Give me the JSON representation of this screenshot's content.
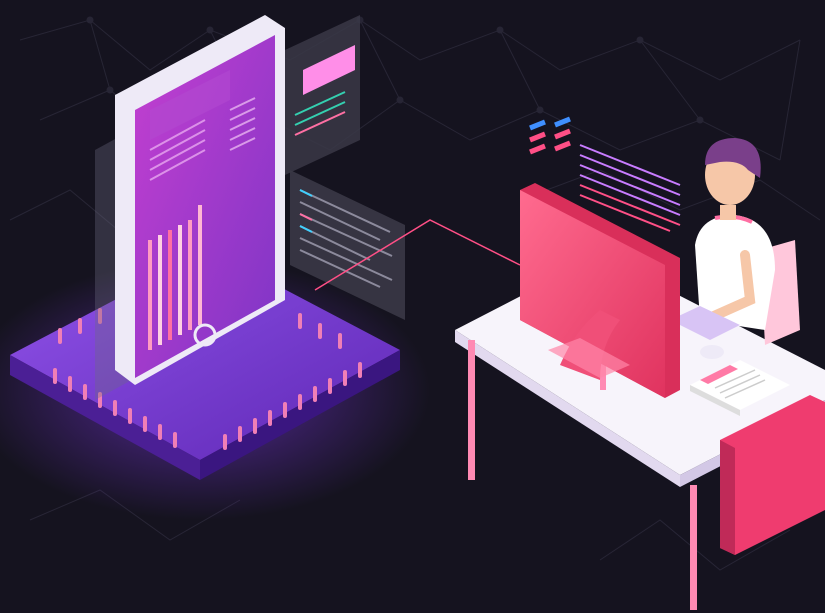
{
  "scene": {
    "description_hidden": "",
    "colors": {
      "background": "#15131f",
      "network": "#2a2838",
      "chip_top": "#7c3fd6",
      "chip_side": "#4b1f95",
      "chip_pin": "#f07fb6",
      "phone_frame": "#eeeaf7",
      "phone_screen": "#9a39c9",
      "accent_pink": "#ff4f86",
      "monitor": "#f04f78",
      "desk_top": "#f7f4fb",
      "desk_leg": "#ff8ab3",
      "cabinet": "#ef3c6f",
      "hair": "#7a3f8a",
      "skin": "#f6c7a8",
      "shirt": "#ffffff",
      "code_panel": "#3a3846",
      "glow": "#8b3bff"
    },
    "icons": [
      "network-background",
      "circuit-chip",
      "smartphone",
      "code-panel",
      "developer-person",
      "desk",
      "computer-monitor",
      "keyboard",
      "mouse",
      "paper-stack"
    ]
  }
}
